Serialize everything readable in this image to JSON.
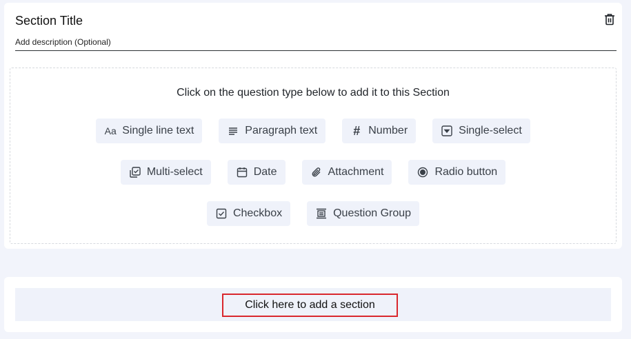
{
  "section": {
    "title": "Section Title",
    "description_placeholder": "Add description (Optional)"
  },
  "drop_zone": {
    "hint": "Click on the question type below to add it to this Section"
  },
  "question_types": {
    "single_line": "Single line text",
    "single_line_icon_text": "Aa",
    "paragraph": "Paragraph text",
    "number": "Number",
    "number_icon_text": "#",
    "single_select": "Single-select",
    "multi_select": "Multi-select",
    "date": "Date",
    "attachment": "Attachment",
    "radio": "Radio button",
    "checkbox": "Checkbox",
    "question_group": "Question Group"
  },
  "add_section": {
    "label": "Click here to add a section"
  },
  "colors": {
    "page_bg": "#f2f4fb",
    "button_bg": "#eff2fa",
    "highlight_border": "#d9262c"
  }
}
